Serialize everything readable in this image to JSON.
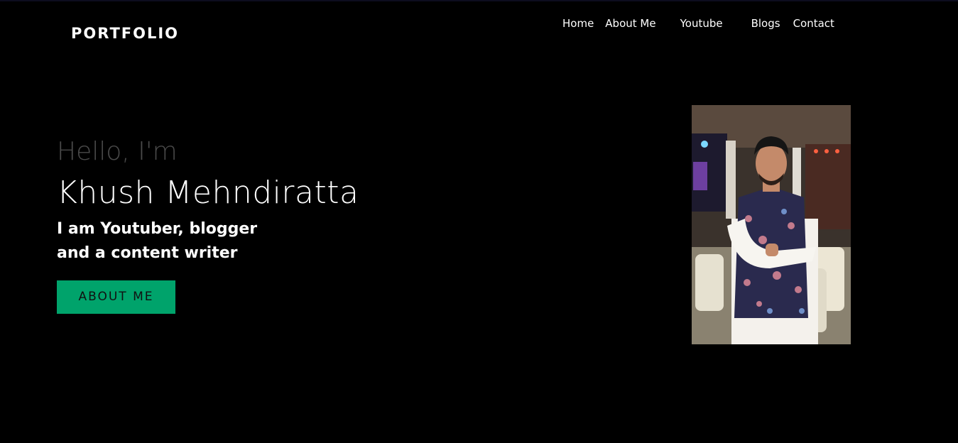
{
  "header": {
    "logo": "PORTFOLIO",
    "nav": [
      {
        "label": "Home"
      },
      {
        "label": "About Me"
      },
      {
        "label": "Youtube"
      },
      {
        "label": "Blogs"
      },
      {
        "label": "Contact"
      }
    ]
  },
  "hero": {
    "greeting": "Hello, I'm",
    "name": "Khush Mehndiratta",
    "tagline_line1": "I am Youtuber, blogger",
    "tagline_line2": "and a content writer",
    "cta_label": "ABOUT ME",
    "photo_icon": "portrait-photo"
  },
  "colors": {
    "background": "#000000",
    "accent": "#00a36b",
    "greeting": "#4a4a4a",
    "text": "#ffffff"
  }
}
